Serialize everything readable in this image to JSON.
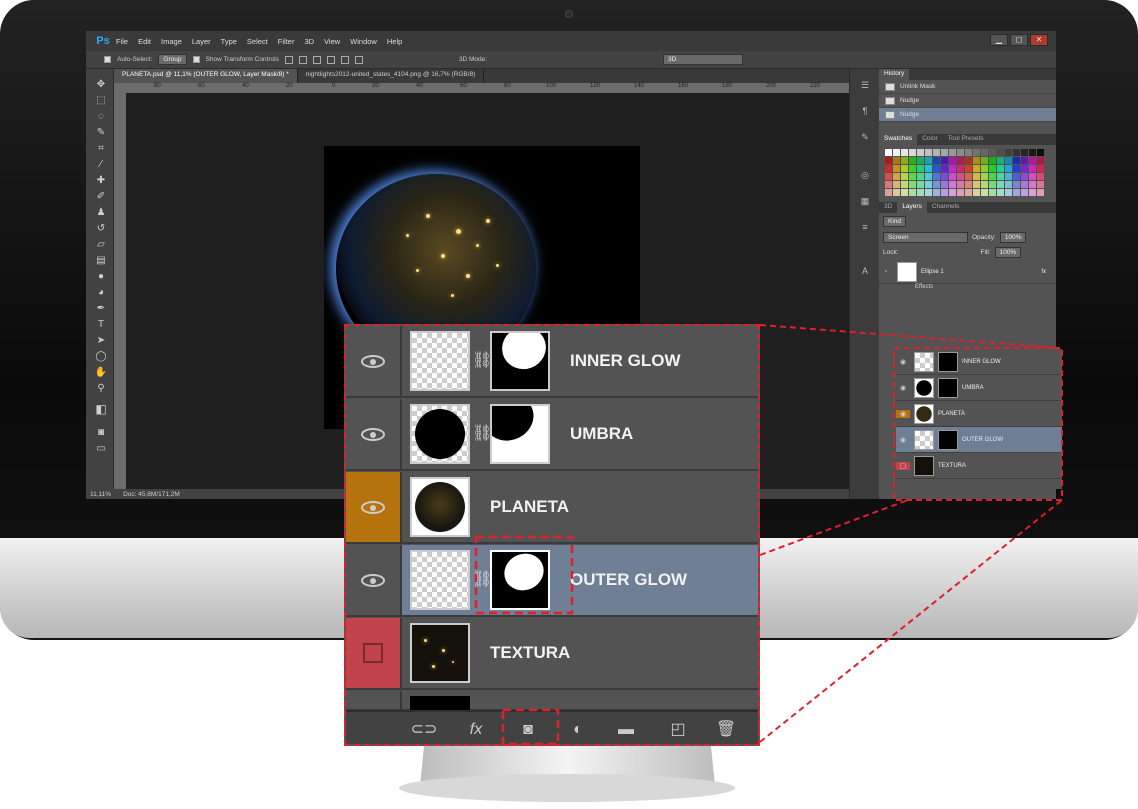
{
  "app": {
    "logo": "Ps",
    "menu": [
      "File",
      "Edit",
      "Image",
      "Layer",
      "Type",
      "Select",
      "Filter",
      "3D",
      "View",
      "Window",
      "Help"
    ],
    "window_buttons": [
      "▁",
      "◻",
      "✕"
    ]
  },
  "options": {
    "auto_select_label": "Auto-Select:",
    "auto_select_value": "Group",
    "transform_label": "Show Transform Controls",
    "mode_label": "3D Mode:",
    "workspace": "3D"
  },
  "tabs": [
    "PLANETA.psd @ 11,1% (OUTER GLOW, Layer Mask/8) *",
    "nightlights2012-united_states_4104.png @ 16,7% (RGB/8)"
  ],
  "status": {
    "zoom": "11,11%",
    "doc": "Doc: 45,8M/171,2M"
  },
  "ruler_ticks": [
    "80",
    "60",
    "40",
    "20",
    "0",
    "20",
    "40",
    "60",
    "80",
    "100",
    "120",
    "140",
    "160",
    "180",
    "200",
    "220"
  ],
  "panels": {
    "history_title": "History",
    "history_items": [
      "Unlink Mask",
      "Nudge",
      "Nudge"
    ],
    "swatch_tabs": [
      "Swatches",
      "Color",
      "Tool Presets"
    ],
    "layer_tabs": [
      "3D",
      "Layers",
      "Channels"
    ],
    "kind": "Kind",
    "blend_mode": "Screen",
    "opacity_label": "Opacity:",
    "opacity": "100%",
    "lock_label": "Lock:",
    "fill_label": "Fill:",
    "fill": "100%",
    "ellipse_layer": "Ellipse 1",
    "effects_label": "Effects",
    "fx": "fx",
    "mini_layers": [
      "INNER GLOW",
      "UMBRA",
      "PLANETA",
      "OUTER GLOW",
      "TEXTURA"
    ]
  },
  "zoom_layers": [
    "INNER GLOW",
    "UMBRA",
    "PLANETA",
    "OUTER GLOW",
    "TEXTURA"
  ],
  "colors": {
    "highlight": "#e0202a",
    "selected_layer": "#6e7f96",
    "orange": "#b5730e",
    "red": "#c2434a"
  }
}
